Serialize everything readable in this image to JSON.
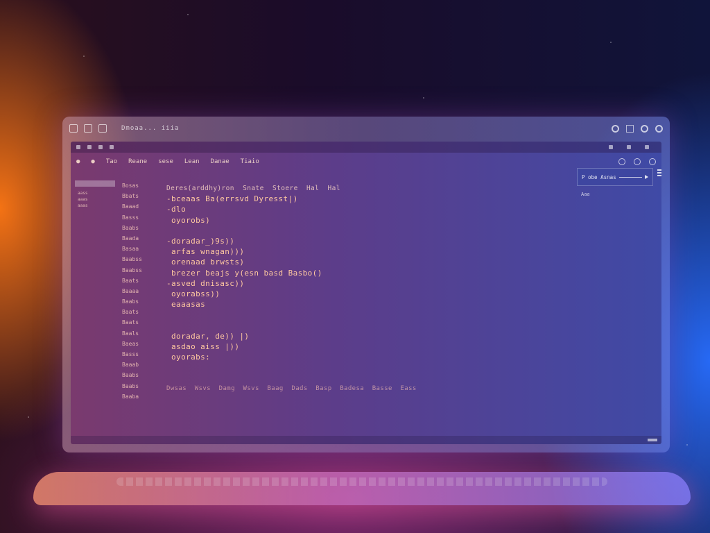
{
  "window": {
    "title": "Dmoaa...  iiia",
    "controls": [
      "close-icon",
      "minimize-icon",
      "maximize-icon"
    ]
  },
  "menu": {
    "items": [
      "Tao",
      "Reane",
      "sese",
      "Lean",
      "Danae",
      "Tiaio"
    ]
  },
  "sidebar": {
    "items": [
      "aass",
      "aaas",
      "aaas"
    ]
  },
  "files": [
    "Bosas",
    "Bbats",
    "Baaad",
    "Basss",
    "Baabs",
    "Baada",
    "Basaa",
    "Baabss",
    "Baabss",
    "Baats",
    "Baaaa",
    "Baabs",
    "Baats",
    "Baats",
    "Baals",
    "Baeas",
    "Basss",
    "Baaab",
    "Baabs",
    "Baabs",
    "Baaba"
  ],
  "editor": {
    "header": "Deres(arddhy)ron  Snate  Stoere  Hal  Hal",
    "lines": [
      "-bceaas Ba(errsvd Dyresst|)",
      "-dlo",
      " oyorobs)",
      "",
      "-doradar_)9s))",
      " arfas wnagan)))",
      " orenaad brwsts)",
      " brezer beajs y(esn basd Basbo()",
      "-asved dnisasc))",
      " oyorabss))",
      " eaaasas",
      "",
      "",
      " doradar, de)) |)",
      " asdao aiss |))",
      " oyorabs:",
      "",
      "",
      "Dwsas  Wsvs  Damg  Wsvs  Baag  Dads  Basp  Badesa  Basse  Eass"
    ]
  },
  "panel": {
    "label": "P obe  Asnas",
    "sub": "Aaa"
  },
  "colors": {
    "code_text": "#ffc9a0",
    "accent_left": "#ff7a1a",
    "accent_right": "#2a6eff"
  }
}
